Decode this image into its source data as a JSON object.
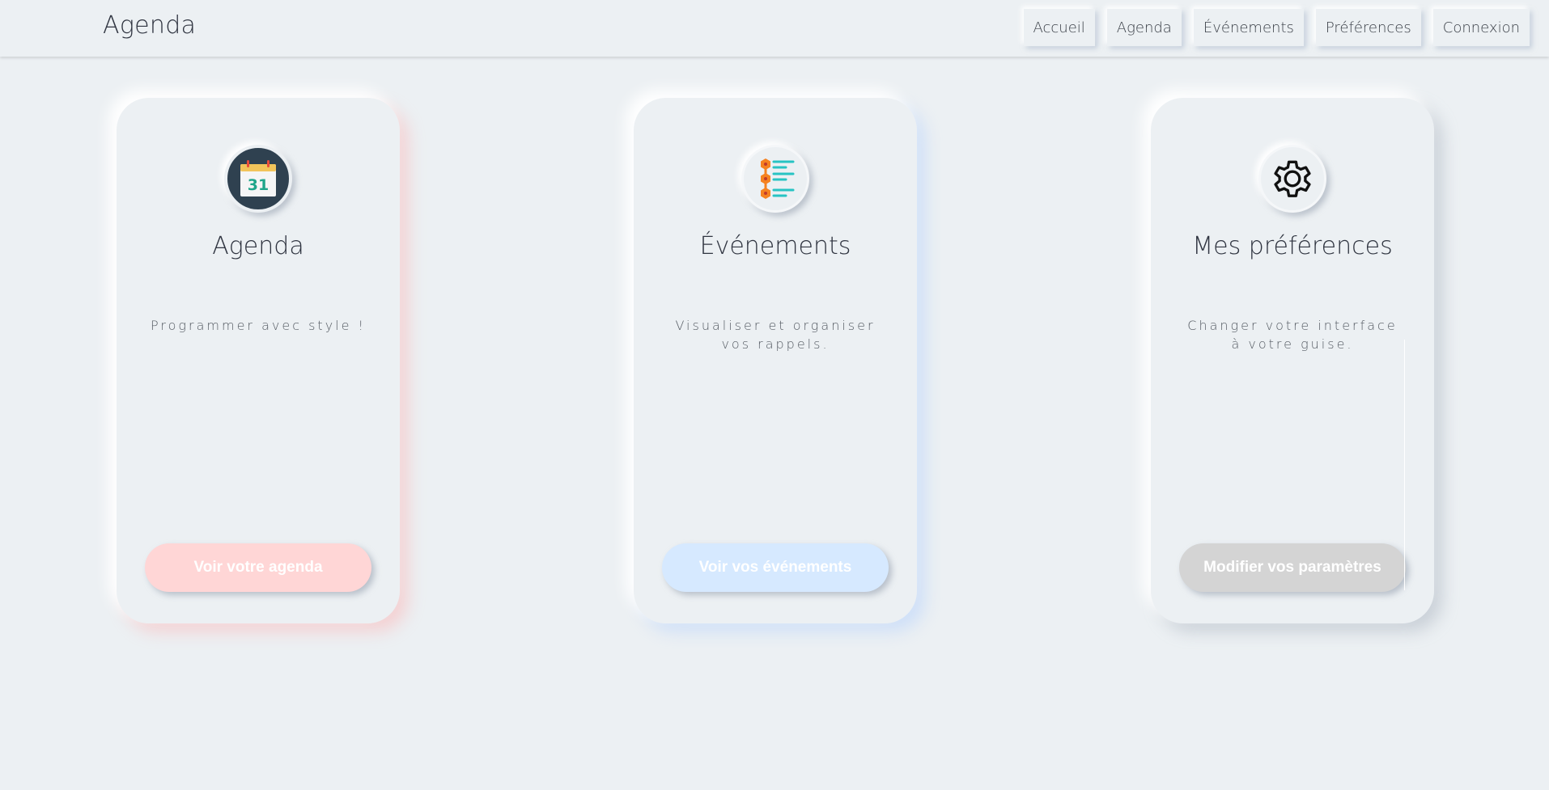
{
  "header": {
    "brand": "Agenda",
    "nav": [
      "Accueil",
      "Agenda",
      "Événements",
      "Préférences",
      "Connexion"
    ]
  },
  "cards": [
    {
      "icon": "calendar-icon",
      "icon_text": "31",
      "title": "Agenda",
      "description": "Programmer avec style !",
      "button": "Voir votre agenda",
      "accent": "#FFD6D6"
    },
    {
      "icon": "event-list-icon",
      "title": "Événements",
      "description": "Visualiser et organiser vos rappels.",
      "button": "Voir vos événements",
      "accent": "#D6E9FF"
    },
    {
      "icon": "gear-icon",
      "title": "Mes préférences",
      "description": "Changer votre interface à votre guise.",
      "button": "Modifier vos paramètres",
      "accent": "#D4D4D4"
    }
  ],
  "colors": {
    "background": "#ECF0F3",
    "text": "#2f3440",
    "calendar_bg": "#2f4150",
    "events_orange": "#F58220",
    "events_teal": "#27C3C3"
  }
}
